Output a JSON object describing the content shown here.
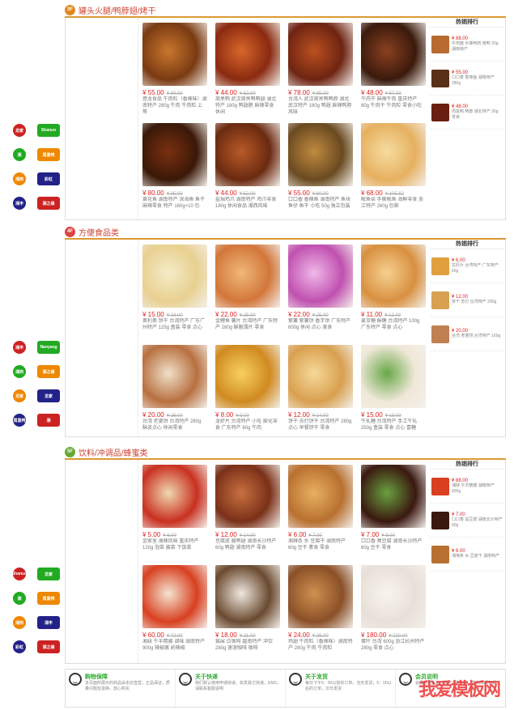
{
  "floors": [
    {
      "badge": "3F",
      "badge_color": "#e08a1e",
      "title": "罐头火腿/鸭脖翅/烤干",
      "products": [
        {
          "price": "¥ 55.00",
          "old": "¥ 80.00",
          "desc": "悠龙食品 牛肉粒（香辣味）湖南特产 280g 牛肉 牛肉粒 上等",
          "c1": "#7a3a12",
          "c2": "#c9772e"
        },
        {
          "price": "¥ 44.00",
          "old": "¥ 52.00",
          "desc": "周黑鸭 武汉周黑鸭鸭翅 湖北特产 180g 鸭翅膀 麻辣零食 休闲",
          "c1": "#8a2a10",
          "c2": "#d8662a"
        },
        {
          "price": "¥ 78.00",
          "old": "¥ 95.00",
          "desc": "台湾人 武汉周黑鸭鸭脖 湖北武汉特产 180g 鸭翅 麻辣鸭脖 风味",
          "c1": "#6e2412",
          "c2": "#bb5020"
        },
        {
          "price": "¥ 48.00",
          "old": "¥ 57.00",
          "desc": "牛肉干 麻辣牛肉 重庆特产 80g 牛肉干 牛肉粒 零食小吃",
          "c1": "#3a1a0c",
          "c2": "#8a4020"
        },
        {
          "price": "¥ 80.00",
          "old": "¥ 95.00",
          "desc": "黄花鱼 湖南特产 深海鱼 鱼干 麻辣零食 特产 160g+10 包",
          "c1": "#3a1808",
          "c2": "#7a3010"
        },
        {
          "price": "¥ 44.00",
          "old": "¥ 52.00",
          "desc": "盐焗鸡爪 湖南特产 鸡爪零食 180g 休闲食品 湘西风味",
          "c1": "#6a2a10",
          "c2": "#b85a28"
        },
        {
          "price": "¥ 55.00",
          "old": "¥ 60.00",
          "desc": "口口香 香辣鱼 湖南特产 鱼块 鱼仔 鱼干 小吃 50g 独立包装",
          "c1": "#6a4a20",
          "c2": "#c08a40"
        },
        {
          "price": "¥ 68.00",
          "old": "¥ 105.82",
          "desc": "鱿鱼丝 手撕鱿鱼 海鲜零食 浙江特产 260g 包邮",
          "c1": "#e6b060",
          "c2": "#f6dca0"
        }
      ],
      "rank_title": "热销排行",
      "rank": [
        {
          "price": "¥ 88.00",
          "text": "牛肉酱 手撕鸭肉 烤鸭 30g 湖南特产",
          "c1": "#b86a30"
        },
        {
          "price": "¥ 55.00",
          "text": "口口香 香辣鱼 湖南特产 280g",
          "c1": "#5a3018"
        },
        {
          "price": "¥ 48.00",
          "text": "周黑鸭 鸭脖 湖北特产 30g 零食",
          "c1": "#6a2010"
        }
      ],
      "brands": [
        [
          "龙家",
          "Shanuo"
        ],
        [
          "湘",
          "周黑鸭"
        ],
        [
          "湘西",
          "彩虹"
        ],
        [
          "湘丰",
          "湘之缘"
        ]
      ]
    },
    {
      "badge": "4F",
      "badge_color": "#d44",
      "title": "方便食品类",
      "products": [
        {
          "price": "¥ 15.00",
          "old": "¥ 18.00",
          "desc": "奥利奥 饼干 台湾特产 广东广州特产 125g 盒装 零食 点心",
          "c1": "#e8d090",
          "c2": "#f4ecc8"
        },
        {
          "price": "¥ 22.00",
          "old": "¥ 25.00",
          "desc": "金鲤鱼 薯片 台湾特产 广东特产 280g 酥脆薄片 零食",
          "c1": "#d2763a",
          "c2": "#f0b878"
        },
        {
          "price": "¥ 22.00",
          "old": "¥ 25.00",
          "desc": "紫薯 紫薯饼 香芋饼 广东特产 600g 休闲 点心 美食",
          "c1": "#c050b0",
          "c2": "#f0b8e8"
        },
        {
          "price": "¥ 11.00",
          "old": "¥ 12.00",
          "desc": "麦芽糖 酥糖 台湾特产 100g 广东特产 零食 点心",
          "c1": "#d89040",
          "c2": "#f6d090"
        },
        {
          "price": "¥ 20.00",
          "old": "¥ 26.00",
          "desc": "台湾 老婆饼 台湾特产 280g 酥皮点心 休闲零食",
          "c1": "#b87040",
          "c2": "#f0e0c8"
        },
        {
          "price": "¥ 8.00",
          "old": "¥ 9.00",
          "desc": "龙虾片 台湾特产 小吃 膨化零食 广东特产 60g 牛肉",
          "c1": "#d08a20",
          "c2": "#f8d060"
        },
        {
          "price": "¥ 12.00",
          "old": "¥ 14.00",
          "desc": "饼干 苏打饼干 台湾特产 280g 点心 早餐饼干 零食",
          "c1": "#d8a050",
          "c2": "#f6d898"
        },
        {
          "price": "¥ 15.00",
          "old": "¥ 18.00",
          "desc": "牛轧糖 台湾特产 手工牛轧 250g 盒装 零食 点心 喜糖",
          "c1": "#f0e8d8",
          "c2": "#68a848"
        }
      ],
      "rank_title": "热销排行",
      "rank": [
        {
          "price": "¥ 6.00",
          "text": "龙虾片 台湾特产 广东特产 60g",
          "c1": "#e0a040"
        },
        {
          "price": "¥ 12.00",
          "text": "饼干 苏打 台湾特产 280g",
          "c1": "#d8a050"
        },
        {
          "price": "¥ 20.00",
          "text": "台湾 老婆饼 台湾特产 160g",
          "c1": "#c08050"
        }
      ],
      "brands": [
        [
          "湘丰",
          "Nanyang"
        ],
        [
          "湘西",
          "湘之缘"
        ],
        [
          "龙家",
          "龙家"
        ],
        [
          "周黑鸭",
          "湘"
        ]
      ]
    },
    {
      "badge": "5F",
      "badge_color": "#6a3",
      "title": "饮料/冲调品/蜂蜜类",
      "products": [
        {
          "price": "¥ 5.00",
          "old": "¥ 6.00",
          "desc": "金家里 湘辣风味 重庆特产 120g 泡菜 酱菜 下饭菜",
          "c1": "#c83020",
          "c2": "#f0d8b0"
        },
        {
          "price": "¥ 12.00",
          "old": "¥ 14.00",
          "desc": "豆腐皮 酱鸭翅 湖南长沙特产 60g 鸭翅 湖南特产 零食",
          "c1": "#7a3018",
          "c2": "#c87040"
        },
        {
          "price": "¥ 6.00",
          "old": "¥ 7.00",
          "desc": "湘辣条 水 豆腐干 湖南特产 60g 豆干 素食 零食",
          "c1": "#b87030",
          "c2": "#e8b060"
        },
        {
          "price": "¥ 7.00",
          "old": "¥ 8.00",
          "desc": "口口香 臭豆腐 湖南长沙特产 60g 豆干 零食",
          "c1": "#3a1810",
          "c2": "#6aa040"
        },
        {
          "price": "¥ 60.00",
          "old": "¥ 72.00",
          "desc": "湘妹 牛羊精酱 调味 湖南特产 900g 辣椒酱 剁辣椒",
          "c1": "#d84020",
          "c2": "#f4e4d0"
        },
        {
          "price": "¥ 18.00",
          "old": "¥ 21.00",
          "desc": "猫屎 白咖啡 越南特产 冲饮 280g 速溶咖啡 咖啡",
          "c1": "#6a4a30",
          "c2": "#f0e8e0"
        },
        {
          "price": "¥ 24.00",
          "old": "¥ 26.00",
          "desc": "鸡翅 牛肉粒（香辣味）湖南特产 280g 牛肉 牛肉粒",
          "c1": "#8a5028",
          "c2": "#d09050"
        },
        {
          "price": "¥ 180.00",
          "old": "¥ 220.00",
          "desc": "蛋叶 台湾 600g 浙江杭州特产 280g 零食 点心",
          "c1": "#e8e0d8",
          "c2": "#f8f4ee"
        }
      ],
      "rank_title": "热销排行",
      "rank": [
        {
          "price": "¥ 88.00",
          "text": "湘妹 牛羊精酱 湖南特产 900g",
          "c1": "#d84020"
        },
        {
          "price": "¥ 7.00",
          "text": "口口香 臭豆腐 湖南长沙特产 60g",
          "c1": "#3a1810"
        },
        {
          "price": "¥ 6.00",
          "text": "湘辣条 水 豆腐干 湖南特产",
          "c1": "#b87030"
        }
      ],
      "brands": [
        [
          "Shanuo",
          "龙家"
        ],
        [
          "湘",
          "周黑鸭"
        ],
        [
          "湘西",
          "湘丰"
        ],
        [
          "彩虹",
          "湘之缘"
        ]
      ]
    }
  ],
  "footer": [
    {
      "title": "购物保障",
      "text": "本页面所展示的商品由本店直营，正品保证，质量问题包退换，放心购买"
    },
    {
      "title": "关于快递",
      "text": "我们默认使用申通快递，如发其它快递，EMS，请联系客服说明"
    },
    {
      "title": "关于发货",
      "text": "每日下午5：00以前的订单，当天发货，5：00以后的订单，次日发货"
    },
    {
      "title": "会员说明",
      "text": "会员享受折扣，积分兑换礼品，购物满额包邮"
    }
  ],
  "watermark": "我爱模板网"
}
